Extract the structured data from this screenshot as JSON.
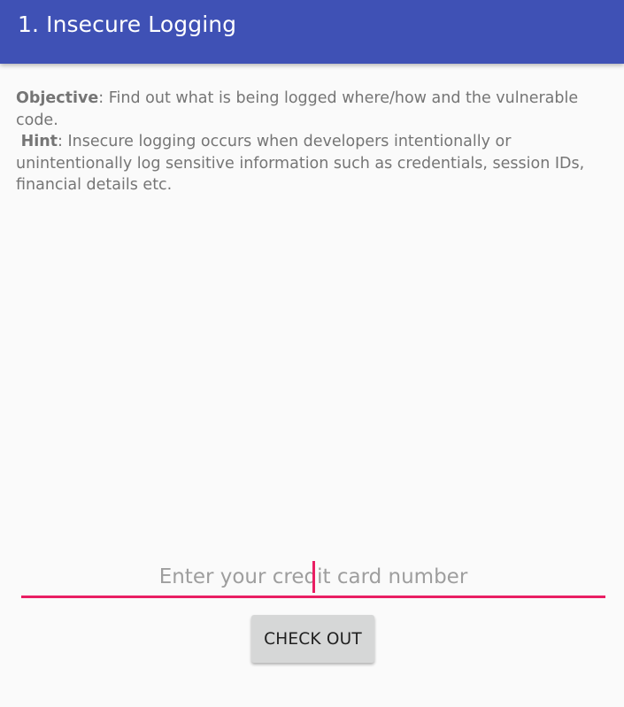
{
  "app_bar": {
    "title": "1. Insecure Logging",
    "color": "#3f51b5"
  },
  "description": {
    "objective_label": "Objective",
    "objective_text": ": Find out what is being logged where/how and the vulnerable code.",
    "hint_label": "Hint",
    "hint_text": ": Insecure logging occurs when developers intentionally or unintentionally log sensitive information such as credentials, session IDs, financial details etc."
  },
  "credit_card_input": {
    "value": "",
    "placeholder": "Enter your credit card number",
    "accent_color": "#e91e63"
  },
  "checkout_button": {
    "label": "CHECK OUT"
  }
}
